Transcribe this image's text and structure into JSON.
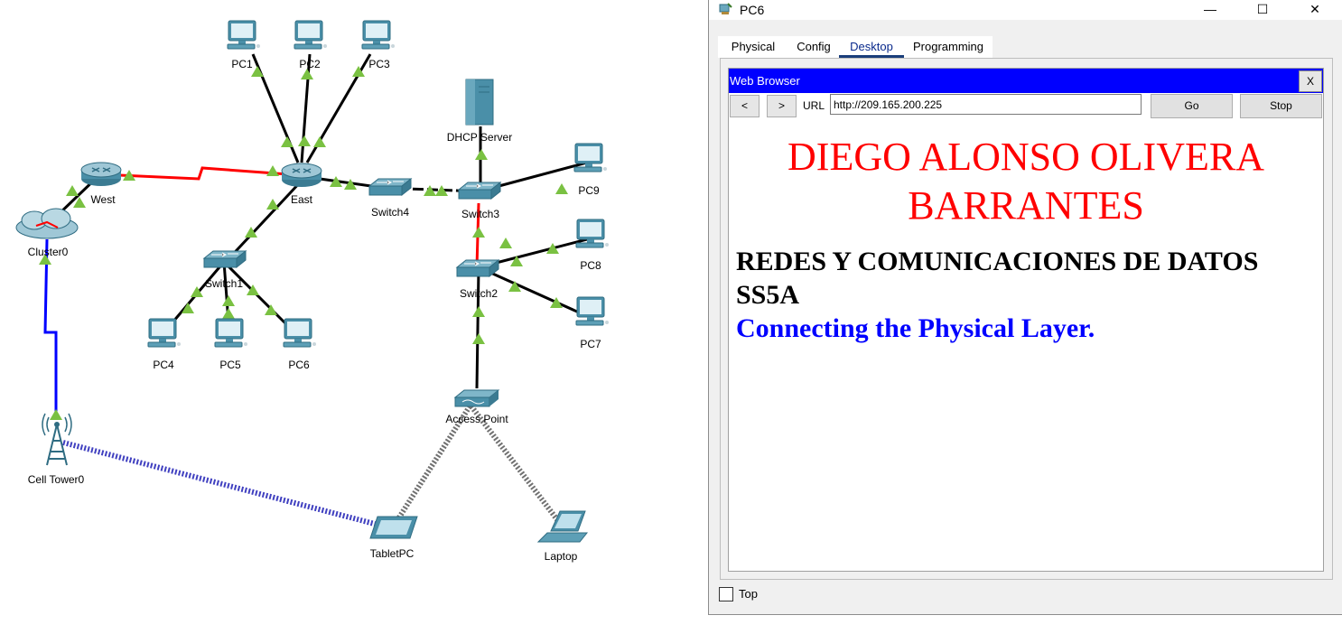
{
  "topology": {
    "nodes": {
      "pc1": "PC1",
      "pc2": "PC2",
      "pc3": "PC3",
      "west": "West",
      "east": "East",
      "cluster0": "Cluster0",
      "dhcp_server": "DHCP Server",
      "switch4": "Switch4",
      "switch3": "Switch3",
      "pc9": "PC9",
      "pc8": "PC8",
      "pc7": "PC7",
      "switch2": "Switch2",
      "switch1": "Switch1",
      "pc4": "PC4",
      "pc5": "PC5",
      "pc6": "PC6",
      "access_point": "Access Point",
      "cell_tower0": "Cell Tower0",
      "tablet_pc": "TabletPC",
      "laptop": "Laptop"
    },
    "colors": {
      "copper": "#000000",
      "serial": "#ff0000",
      "fiber": "#0000ff",
      "wireless": "#555555",
      "link_up": "#7ac142",
      "device": "#4a90a4"
    }
  },
  "window": {
    "title": "PC6",
    "icons": {
      "app": "packet-tracer-pc-icon",
      "minimize": "minimize-icon",
      "maximize": "maximize-icon",
      "close": "close-icon"
    },
    "tabs": [
      "Physical",
      "Config",
      "Desktop",
      "Programming"
    ],
    "active_tab": "Desktop",
    "browser": {
      "title": "Web Browser",
      "close_label": "X",
      "back_label": "<",
      "forward_label": ">",
      "url_label": "URL",
      "url_value": "http://209.165.200.225",
      "go_label": "Go",
      "stop_label": "Stop",
      "page": {
        "heading_line1": "DIEGO ALONSO OLIVERA",
        "heading_line2": "BARRANTES",
        "line1": "REDES Y COMUNICACIONES DE DATOS",
        "line2": "SS5A",
        "line3": "Connecting the Physical Layer.",
        "colors": {
          "heading": "#ff0000",
          "body": "#000000",
          "accent": "#0000ff"
        }
      }
    },
    "top_label": "Top",
    "top_checked": false
  }
}
